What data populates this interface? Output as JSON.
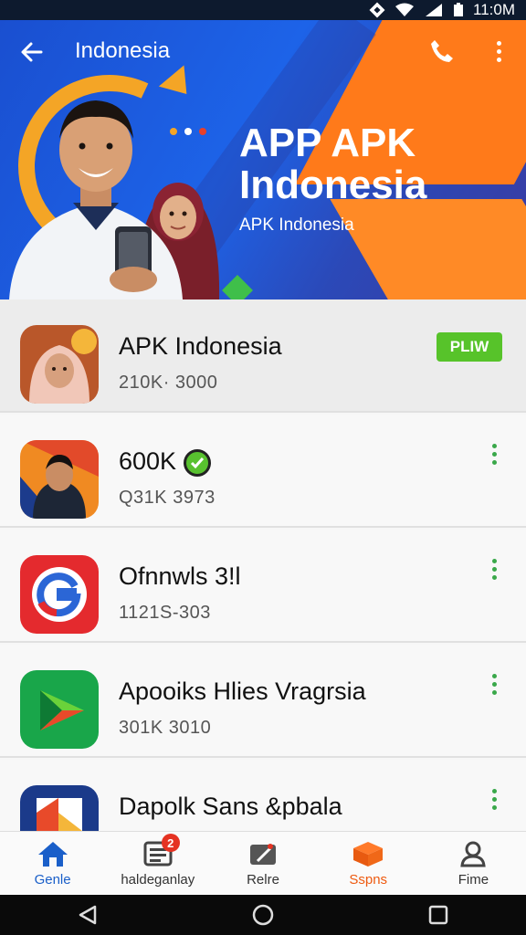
{
  "status_bar": {
    "time": "11:0M"
  },
  "header": {
    "title": "Indonesia",
    "promo_title": "APP APK Indonesia",
    "promo_subtitle": "APK Indonesia"
  },
  "apps": [
    {
      "name": "APK Indonesia",
      "meta": "210K· 3000",
      "action_label": "PLIW"
    },
    {
      "name": "600K",
      "meta": "Q31K 3973"
    },
    {
      "name": "Ofnnwls 3!l",
      "meta": "1121S-303"
    },
    {
      "name": "Apooiks Hlies Vragrsia",
      "meta": "301K 3010"
    },
    {
      "name": "Dapolk Sans &pbala",
      "meta": ""
    }
  ],
  "bottom_nav": [
    {
      "label": "Genle",
      "icon": "home-icon",
      "state": "active"
    },
    {
      "label": "haldeganlay",
      "icon": "news-icon",
      "badge": "2"
    },
    {
      "label": "Relre",
      "icon": "edit-icon"
    },
    {
      "label": "Sspns",
      "icon": "box-icon",
      "state": "highlight"
    },
    {
      "label": "Fime",
      "icon": "person-icon"
    }
  ],
  "colors": {
    "header_blue": "#1d63e8",
    "accent_orange": "#ff7a1a",
    "install_green": "#57c32a",
    "nav_active": "#1a5fc9",
    "nav_hot": "#ee5a10"
  }
}
